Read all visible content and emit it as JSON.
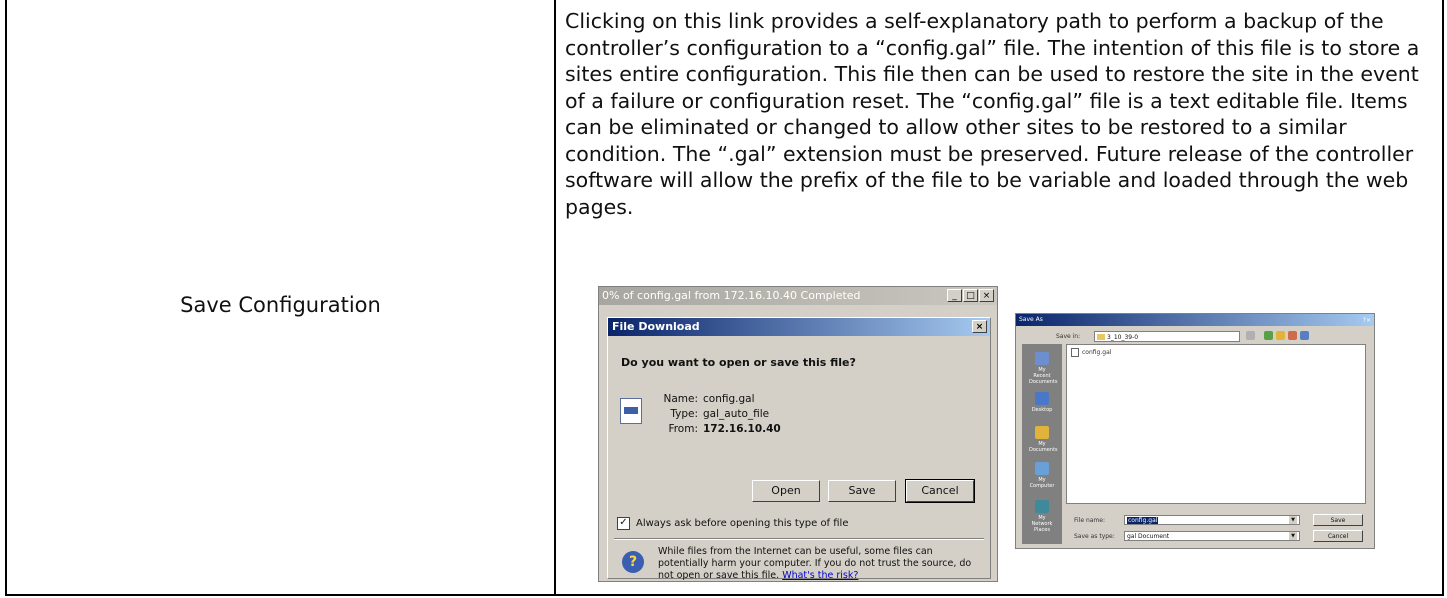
{
  "row": {
    "label": "Save Configuration",
    "description": "Clicking on this link provides a self-explanatory path to perform a backup of the controller’s configuration to a “config.gal” file. The intention of this file is to store a sites entire configuration. This file then can be used to restore the site in the event of a failure or configuration reset. The “config.gal” file is a text editable file. Items can be eliminated or changed to allow other sites to be restored to a similar condition. The “.gal” extension must be preserved. Future release of the controller software will allow the prefix of the file to be variable and loaded through the web pages."
  },
  "download_dialog": {
    "outer_title": "0% of config.gal from 172.16.10.40 Completed",
    "title": "File Download",
    "question": "Do you want to open or save this file?",
    "name_label": "Name:",
    "name_value": "config.gal",
    "type_label": "Type:",
    "type_value": "gal_auto_file",
    "from_label": "From:",
    "from_value": "172.16.10.40",
    "buttons": {
      "open": "Open",
      "save": "Save",
      "cancel": "Cancel"
    },
    "checkbox_label": "Always ask before opening this type of file",
    "warning": "While files from the Internet can be useful, some files can potentially harm your computer. If you do not trust the source, do not open or save this file.",
    "warning_link": "What's the risk?"
  },
  "save_as_dialog": {
    "title": "Save As",
    "save_in_label": "Save in:",
    "save_in_value": "3_10_39-0",
    "file_item": "config.gal",
    "places": [
      "My Recent Documents",
      "Desktop",
      "My Documents",
      "My Computer",
      "My Network Places"
    ],
    "file_name_label": "File name:",
    "file_name_value": "config.gal",
    "save_type_label": "Save as type:",
    "save_type_value": "gal Document",
    "save_button": "Save",
    "cancel_button": "Cancel"
  },
  "colors": {
    "dialog_bg": "#d4d0c8",
    "titlebar": "#0a246a",
    "border": "#000000"
  }
}
